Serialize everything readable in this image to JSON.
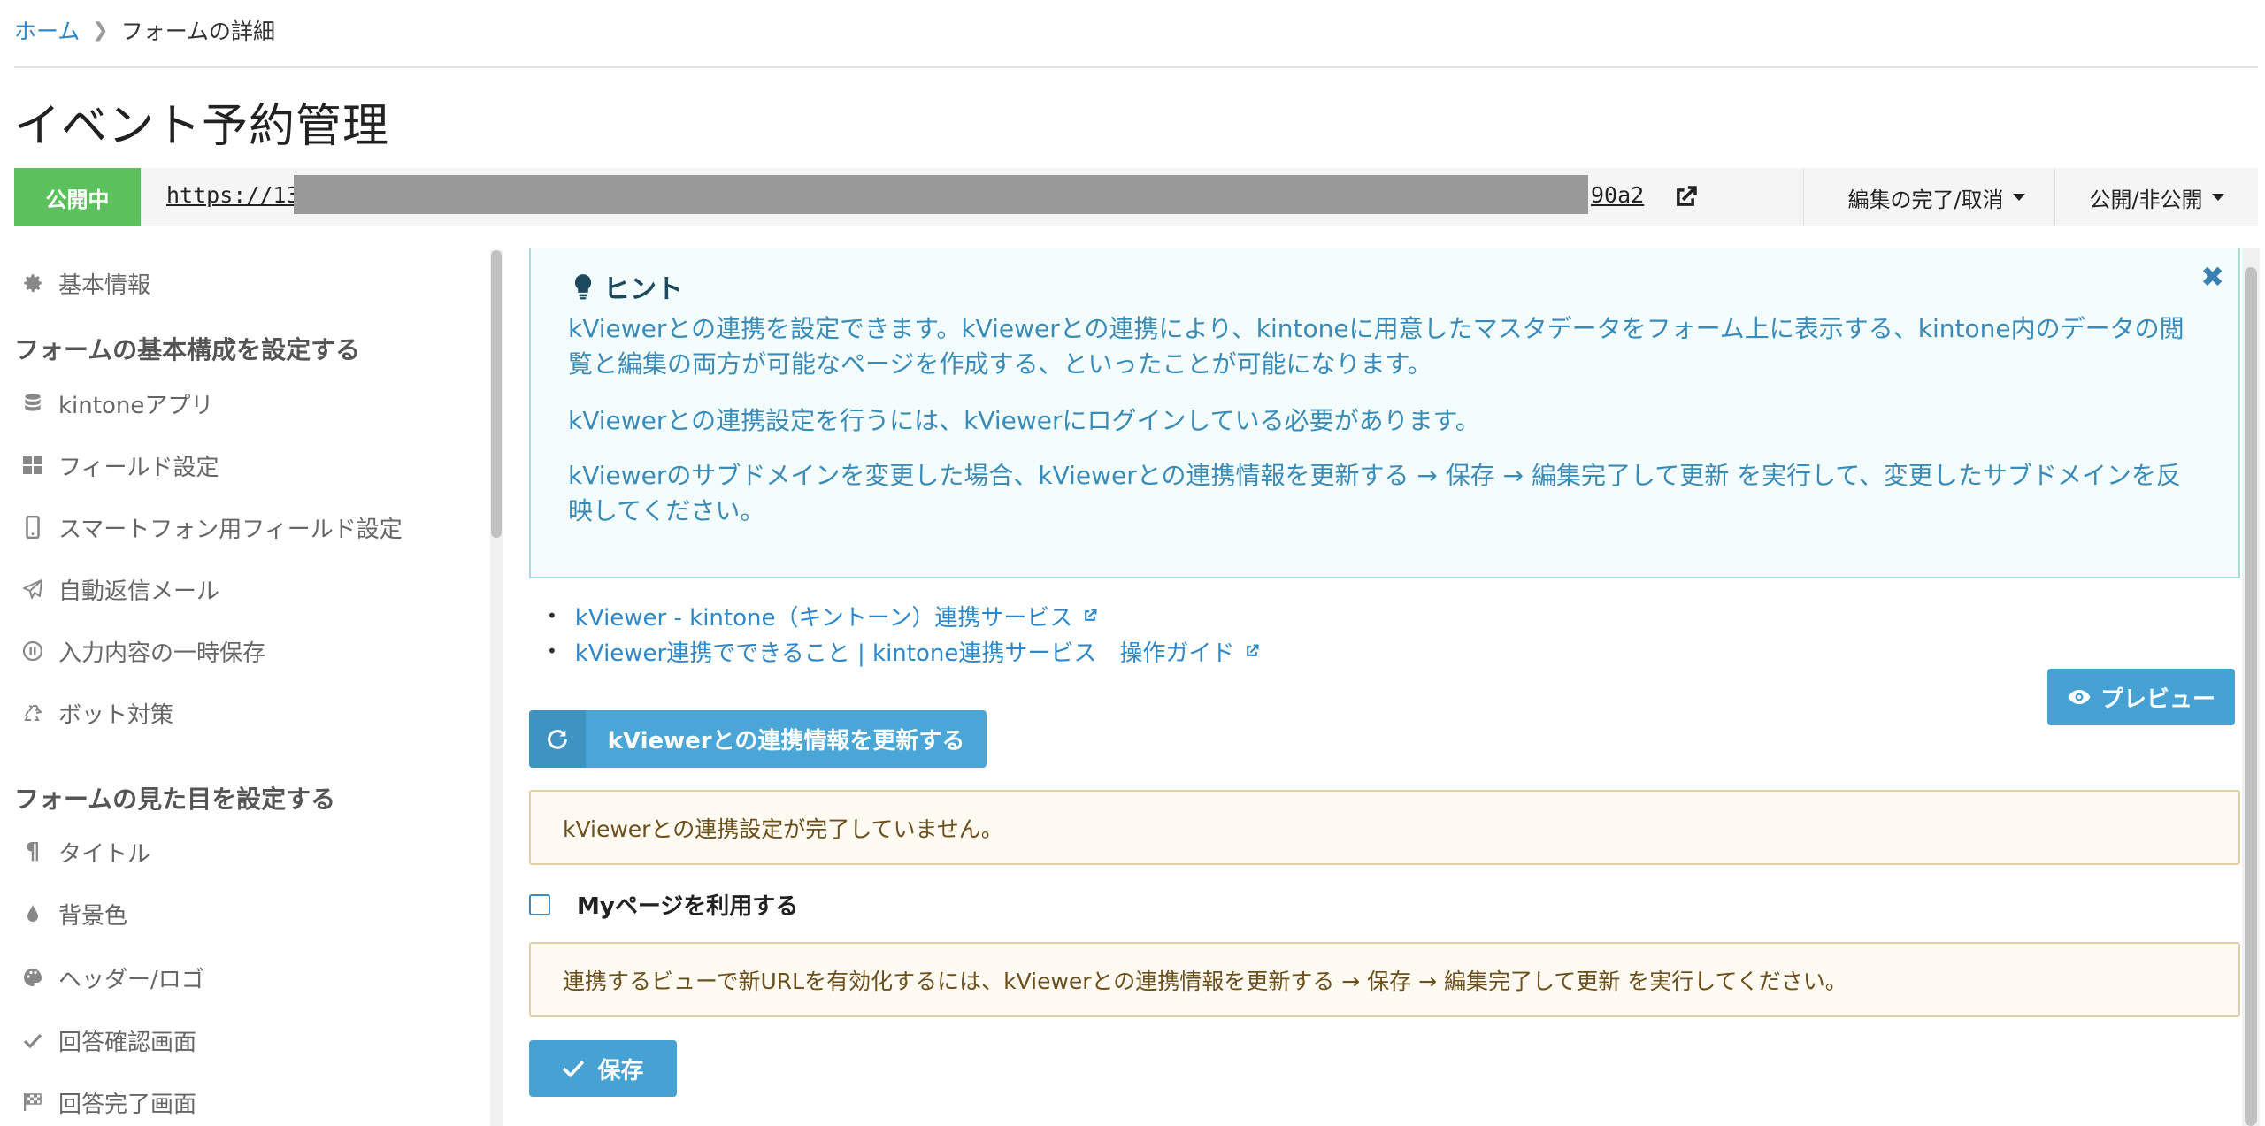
{
  "breadcrumb": {
    "home": "ホーム",
    "current": "フォームの詳細"
  },
  "page": {
    "title": "イベント予約管理"
  },
  "urlbar": {
    "status": "公開中",
    "url_prefix": "https://13d",
    "url_suffix": "90a2",
    "edit_menu": "編集の完了/取消",
    "publish_menu": "公開/非公開",
    "status_color": "#5cc15c"
  },
  "sidebar": {
    "basic_info": "基本情報",
    "section1": "フォームの基本構成を設定する",
    "section1_items": [
      {
        "label": "kintoneアプリ",
        "icon": "database-icon"
      },
      {
        "label": "フィールド設定",
        "icon": "grid-icon"
      },
      {
        "label": "スマートフォン用フィールド設定",
        "icon": "mobile-icon"
      },
      {
        "label": "自動返信メール",
        "icon": "paper-plane-icon"
      },
      {
        "label": "入力内容の一時保存",
        "icon": "pause-circle-icon"
      },
      {
        "label": "ボット対策",
        "icon": "recycle-icon"
      }
    ],
    "section2": "フォームの見た目を設定する",
    "section2_items": [
      {
        "label": "タイトル",
        "icon": "paragraph-icon"
      },
      {
        "label": "背景色",
        "icon": "tint-icon"
      },
      {
        "label": "ヘッダー/ロゴ",
        "icon": "palette-icon"
      },
      {
        "label": "回答確認画面",
        "icon": "check-icon"
      },
      {
        "label": "回答完了画面",
        "icon": "flag-checkered-icon"
      }
    ]
  },
  "hint": {
    "title": "ヒント",
    "p1": "kViewerとの連携を設定できます。kViewerとの連携により、kintoneに用意したマスタデータをフォーム上に表示する、kintone内のデータの閲覧と編集の両方が可能なページを作成する、といったことが可能になります。",
    "p2": "kViewerとの連携設定を行うには、kViewerにログインしている必要があります。",
    "p3": "kViewerのサブドメインを変更した場合、kViewerとの連携情報を更新する → 保存 → 編集完了して更新 を実行して、変更したサブドメインを反映してください。"
  },
  "links": [
    "kViewer - kintone（キントーン）連携サービス",
    "kViewer連携でできること | kintone連携サービス　操作ガイド"
  ],
  "buttons": {
    "preview": "プレビュー",
    "refresh": "kViewerとの連携情報を更新する",
    "save": "保存"
  },
  "messages": {
    "not_configured": "kViewerとの連携設定が完了していません。",
    "new_url_notice": "連携するビューで新URLを有効化するには、kViewerとの連携情報を更新する → 保存 → 編集完了して更新 を実行してください。"
  },
  "mypage": {
    "label": "Myページを利用する",
    "checked": false
  },
  "colors": {
    "accent": "#45a2d2",
    "link": "#2e87c8",
    "hint_text": "#3a8bb8"
  }
}
